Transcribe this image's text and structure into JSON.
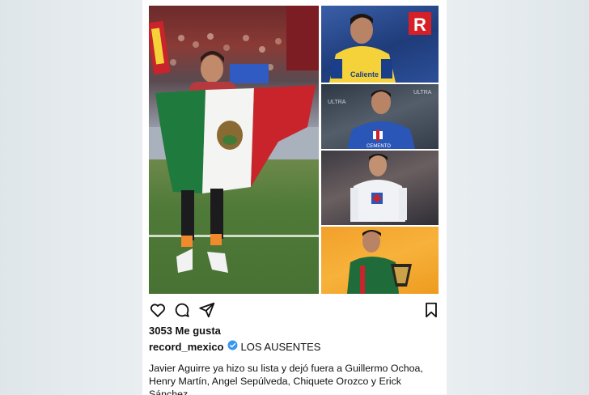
{
  "post": {
    "likes_text": "3053 Me gusta",
    "username": "record_mexico",
    "verified_icon": "verified-badge-icon",
    "caption_title": "LOS AUSENTES",
    "caption_body": "Javier Aguirre ya hizo su lista y dejó fuera a Guillermo Ochoa, Henry Martín, Angel Sepúlveda, Chiquete Orozco y Erick Sánchez."
  },
  "actions": {
    "like_icon": "heart-icon",
    "comment_icon": "comment-icon",
    "share_icon": "send-icon",
    "save_icon": "bookmark-icon"
  },
  "collage": {
    "logo_letter": "R",
    "jersey_text_yellow": "Caliente",
    "jersey_text_blue": "CEMENTO",
    "backdrop_text": "ULTRA",
    "colors": {
      "flag_green": "#1f7a3d",
      "flag_white": "#f4f4f2",
      "flag_red": "#c9242b",
      "yellow_jersey": "#f6d23a",
      "cruz_azul_blue": "#2a56b8",
      "orange_bg": "#f4a62a",
      "verified_blue": "#3897f0"
    }
  }
}
